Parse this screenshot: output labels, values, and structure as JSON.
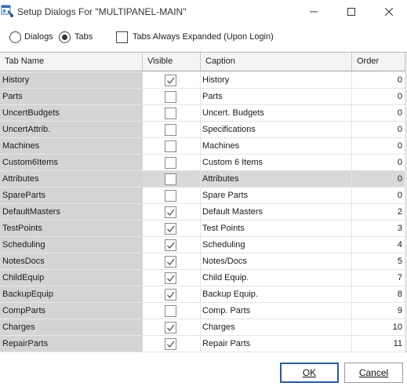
{
  "window": {
    "title": "Setup Dialogs For \"MULTIPANEL-MAIN\"",
    "controls": [
      "minimize-icon",
      "maximize-icon",
      "close-icon"
    ]
  },
  "options": {
    "dialogs_label": "Dialogs",
    "tabs_label": "Tabs",
    "selected": "Tabs",
    "expanded_label": "Tabs Always Expanded (Upon Login)",
    "expanded_checked": false
  },
  "grid": {
    "columns": [
      "Tab Name",
      "Visible",
      "Caption",
      "Order"
    ],
    "selected_row": 6,
    "rows": [
      {
        "name": "History",
        "visible": true,
        "caption": "History",
        "order": "0"
      },
      {
        "name": "Parts",
        "visible": false,
        "caption": "Parts",
        "order": "0"
      },
      {
        "name": "UncertBudgets",
        "visible": false,
        "caption": "Uncert. Budgets",
        "order": "0"
      },
      {
        "name": "UncertAttrib.",
        "visible": false,
        "caption": "Specifications",
        "order": "0"
      },
      {
        "name": "Machines",
        "visible": false,
        "caption": "Machines",
        "order": "0"
      },
      {
        "name": "Custom6Items",
        "visible": false,
        "caption": "Custom 6 Items",
        "order": "0"
      },
      {
        "name": "Attributes",
        "visible": false,
        "caption": "Attributes",
        "order": "0"
      },
      {
        "name": "SpareParts",
        "visible": false,
        "caption": "Spare Parts",
        "order": "0"
      },
      {
        "name": "DefaultMasters",
        "visible": true,
        "caption": "Default Masters",
        "order": "2"
      },
      {
        "name": "TestPoints",
        "visible": true,
        "caption": "Test Points",
        "order": "3"
      },
      {
        "name": "Scheduling",
        "visible": true,
        "caption": "Scheduling",
        "order": "4"
      },
      {
        "name": "NotesDocs",
        "visible": true,
        "caption": "Notes/Docs",
        "order": "5"
      },
      {
        "name": "ChildEquip",
        "visible": true,
        "caption": "Child Equip.",
        "order": "7"
      },
      {
        "name": "BackupEquip",
        "visible": true,
        "caption": "Backup Equip.",
        "order": "8"
      },
      {
        "name": "CompParts",
        "visible": false,
        "caption": "Comp. Parts",
        "order": "9"
      },
      {
        "name": "Charges",
        "visible": true,
        "caption": "Charges",
        "order": "10"
      },
      {
        "name": "RepairParts",
        "visible": true,
        "caption": "Repair Parts",
        "order": "11"
      }
    ]
  },
  "buttons": {
    "ok": "OK",
    "cancel": "Cancel"
  },
  "colors": {
    "name_column_bg": "#d4d4d4",
    "selected_row_bg": "#d9d9d9",
    "default_button_border": "#2a5b9b"
  }
}
